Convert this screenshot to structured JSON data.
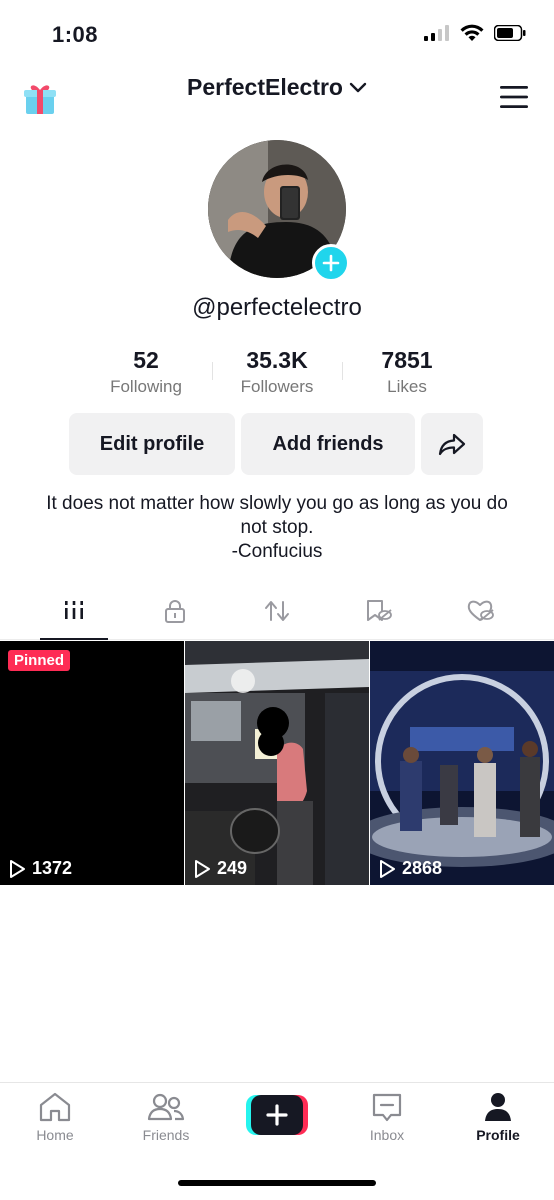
{
  "status_bar": {
    "time": "1:08"
  },
  "header": {
    "account_name": "PerfectElectro"
  },
  "profile": {
    "username": "@perfectelectro",
    "stats": [
      {
        "value": "52",
        "label": "Following"
      },
      {
        "value": "35.3K",
        "label": "Followers"
      },
      {
        "value": "7851",
        "label": "Likes"
      }
    ],
    "buttons": {
      "edit": "Edit profile",
      "add_friends": "Add friends"
    },
    "bio": {
      "line1": "It does not matter how slowly you go as long as you do not stop.",
      "line2": "-Confucius"
    }
  },
  "tabs": [
    {
      "icon": "grid-icon",
      "active": true
    },
    {
      "icon": "lock-icon",
      "active": false
    },
    {
      "icon": "repost-icon",
      "active": false
    },
    {
      "icon": "bookmark-icon",
      "active": false
    },
    {
      "icon": "liked-icon",
      "active": false
    }
  ],
  "videos": [
    {
      "badge": "Pinned",
      "views": "1372"
    },
    {
      "views": "249"
    },
    {
      "views": "2868"
    }
  ],
  "bottom_nav": {
    "home": "Home",
    "friends": "Friends",
    "inbox": "Inbox",
    "profile": "Profile"
  },
  "colors": {
    "accent_pink": "#fe2c55",
    "accent_cyan": "#20d5ec",
    "text": "#161823"
  }
}
